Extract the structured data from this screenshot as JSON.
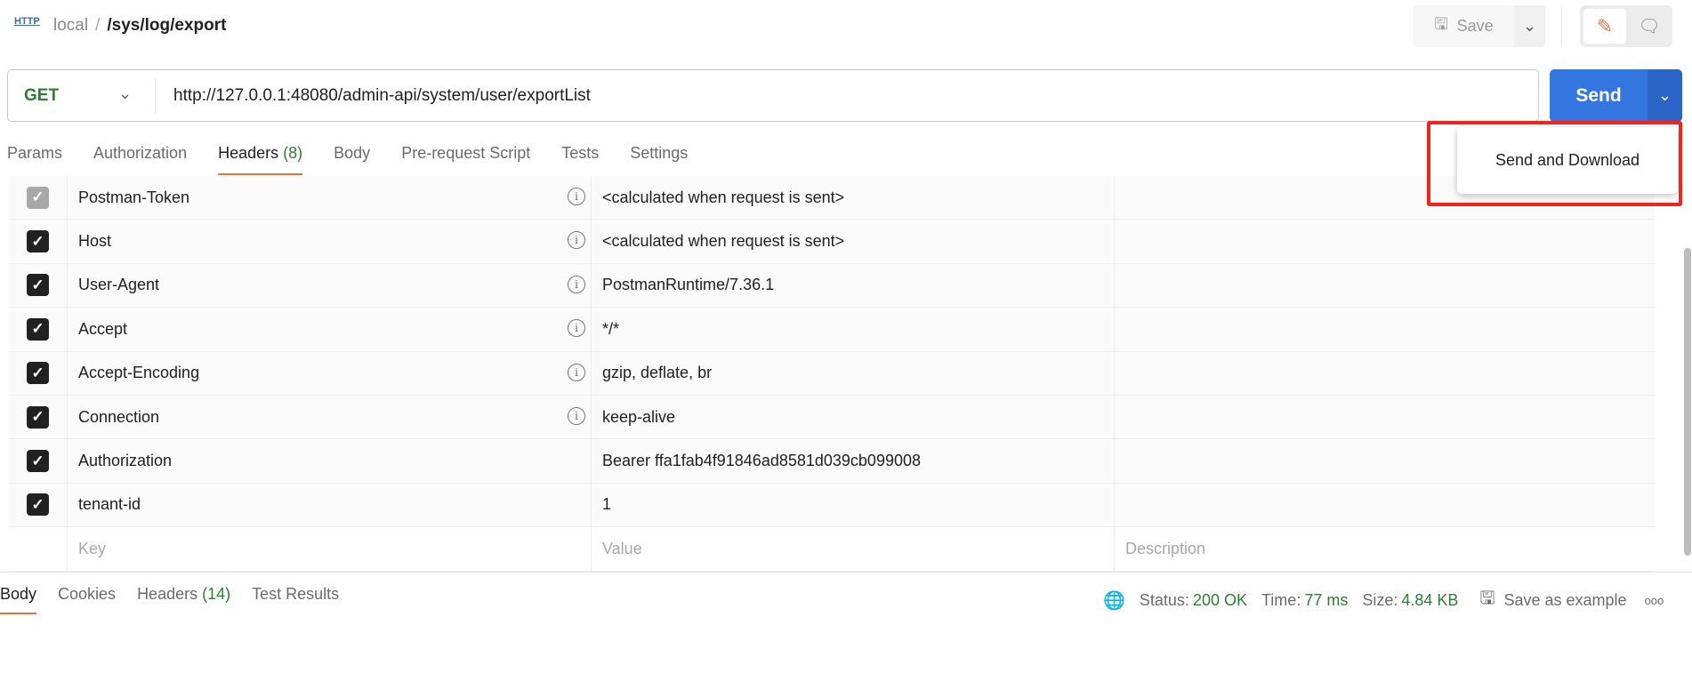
{
  "header": {
    "protocol_icon": "HTTP",
    "collection": "local",
    "separator": "/",
    "request_name": "/sys/log/export",
    "save_label": "Save"
  },
  "request": {
    "method": "GET",
    "url": "http://127.0.0.1:48080/admin-api/system/user/exportList",
    "send_label": "Send"
  },
  "tabs": [
    {
      "label": "Params"
    },
    {
      "label": "Authorization"
    },
    {
      "label": "Headers",
      "count": "(8)"
    },
    {
      "label": "Body"
    },
    {
      "label": "Pre-request Script"
    },
    {
      "label": "Tests"
    },
    {
      "label": "Settings"
    }
  ],
  "headers": [
    {
      "key": "Postman-Token",
      "value": "<calculated when request is sent>",
      "checked": true,
      "disabled": true,
      "info": true
    },
    {
      "key": "Host",
      "value": "<calculated when request is sent>",
      "checked": true,
      "info": true
    },
    {
      "key": "User-Agent",
      "value": "PostmanRuntime/7.36.1",
      "checked": true,
      "info": true
    },
    {
      "key": "Accept",
      "value": "*/*",
      "checked": true,
      "info": true
    },
    {
      "key": "Accept-Encoding",
      "value": "gzip, deflate, br",
      "checked": true,
      "info": true
    },
    {
      "key": "Connection",
      "value": "keep-alive",
      "checked": true,
      "info": true
    },
    {
      "key": "Authorization",
      "value": "Bearer ffa1fab4f91846ad8581d039cb099008",
      "checked": true,
      "info": false
    },
    {
      "key": "tenant-id",
      "value": "1",
      "checked": true,
      "info": false
    }
  ],
  "placeholders": {
    "key": "Key",
    "value": "Value",
    "description": "Description"
  },
  "dropdown": {
    "item": "Send and Download",
    "highlight_color": "#f0241b"
  },
  "response": {
    "tabs": [
      {
        "label": "Body"
      },
      {
        "label": "Cookies"
      },
      {
        "label": "Headers",
        "count": "(14)"
      },
      {
        "label": "Test Results"
      }
    ],
    "status_label": "Status:",
    "status": "200 OK",
    "time_label": "Time:",
    "time": "77 ms",
    "size_label": "Size:",
    "size": "4.84 KB",
    "save_example": "Save as example",
    "more": "ooo"
  },
  "colors": {
    "accent": "#e0763e",
    "send": "#3476e0",
    "success": "#2e7d32"
  }
}
